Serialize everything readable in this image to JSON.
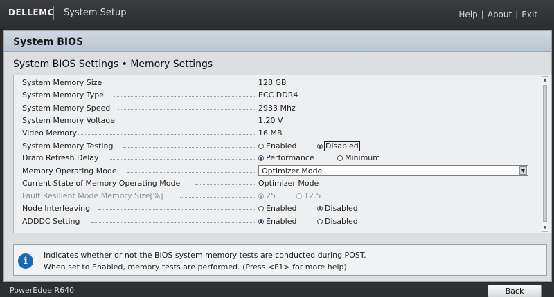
{
  "header": {
    "brand": "DELLEMC",
    "app_title": "System Setup",
    "links": {
      "help": "Help",
      "about": "About",
      "exit": "Exit",
      "separator": "|"
    }
  },
  "section_title": "System BIOS",
  "page_title": "System BIOS Settings • Memory Settings",
  "settings": [
    {
      "label": "System Memory Size",
      "value": "128 GB"
    },
    {
      "label": "System Memory Type",
      "value": "ECC DDR4"
    },
    {
      "label": "System Memory Speed",
      "value": "2933 Mhz"
    },
    {
      "label": "System Memory Voltage",
      "value": "1.20 V"
    },
    {
      "label": "Video Memory",
      "value": "16 MB"
    },
    {
      "label": "System Memory Testing",
      "options": [
        "Enabled",
        "Disabled"
      ],
      "selected": "Disabled"
    },
    {
      "label": "Dram Refresh Delay",
      "options": [
        "Performance",
        "Minimum"
      ],
      "selected": "Performance"
    },
    {
      "label": "Memory Operating Mode",
      "value": "Optimizer Mode"
    },
    {
      "label": "Current State of Memory Operating Mode",
      "value": "Optimizer Mode"
    },
    {
      "label": "Fault Resilient Mode Memory Size[%]",
      "options": [
        "25",
        "12.5"
      ],
      "selected": "25",
      "disabled": true
    },
    {
      "label": "Node Interleaving",
      "options": [
        "Enabled",
        "Disabled"
      ],
      "selected": "Disabled"
    },
    {
      "label": "ADDDC Setting",
      "options": [
        "Enabled",
        "Disabled"
      ],
      "selected": "Enabled"
    }
  ],
  "help": {
    "line1": "Indicates whether or not the BIOS system memory tests are conducted during POST.",
    "line2": "When set to Enabled, memory tests are performed. (Press <F1> for more help)"
  },
  "footer": {
    "model": "PowerEdge R640",
    "back": "Back"
  },
  "colors": {
    "accent": "#1f4a8a",
    "info_icon": "#1a67b3",
    "topbar": "#2b2d30"
  }
}
